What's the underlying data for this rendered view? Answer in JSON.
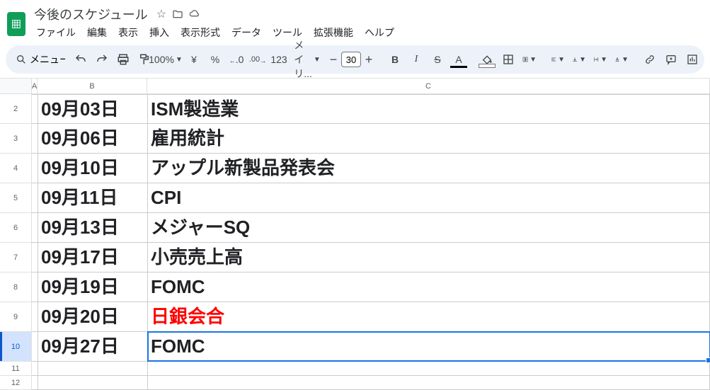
{
  "header": {
    "doc_title": "今後のスケジュール"
  },
  "menubar": {
    "file": "ファイル",
    "edit": "編集",
    "view": "表示",
    "insert": "挿入",
    "format": "表示形式",
    "data": "データ",
    "tools": "ツール",
    "extensions": "拡張機能",
    "help": "ヘルプ"
  },
  "toolbar": {
    "menu_label": "メニュー",
    "zoom": "100%",
    "currency_yen": "¥",
    "percent": "%",
    "dec_decrease": ".0",
    "dec_increase": ".00",
    "num_format": "123",
    "font_name": "メイリ...",
    "font_size": "30",
    "minus": "−",
    "plus": "+",
    "bold": "B",
    "italic": "I",
    "strike": "S",
    "text_color": "A"
  },
  "columns": {
    "a": "A",
    "b": "B",
    "c": "C"
  },
  "rows": [
    {
      "n": "2",
      "date": "09月03日",
      "event": "ISM製造業",
      "red": false
    },
    {
      "n": "3",
      "date": "09月06日",
      "event": "雇用統計",
      "red": false
    },
    {
      "n": "4",
      "date": "09月10日",
      "event": "アップル新製品発表会",
      "red": false
    },
    {
      "n": "5",
      "date": "09月11日",
      "event": "CPI",
      "red": false
    },
    {
      "n": "6",
      "date": "09月13日",
      "event": "メジャーSQ",
      "red": false
    },
    {
      "n": "7",
      "date": "09月17日",
      "event": "小売売上高",
      "red": false
    },
    {
      "n": "8",
      "date": "09月19日",
      "event": "FOMC",
      "red": false
    },
    {
      "n": "9",
      "date": "09月20日",
      "event": "日銀会合",
      "red": true
    },
    {
      "n": "10",
      "date": "09月27日",
      "event": "FOMC",
      "red": false,
      "selected": true
    }
  ],
  "empty_rows": [
    "11",
    "12"
  ]
}
